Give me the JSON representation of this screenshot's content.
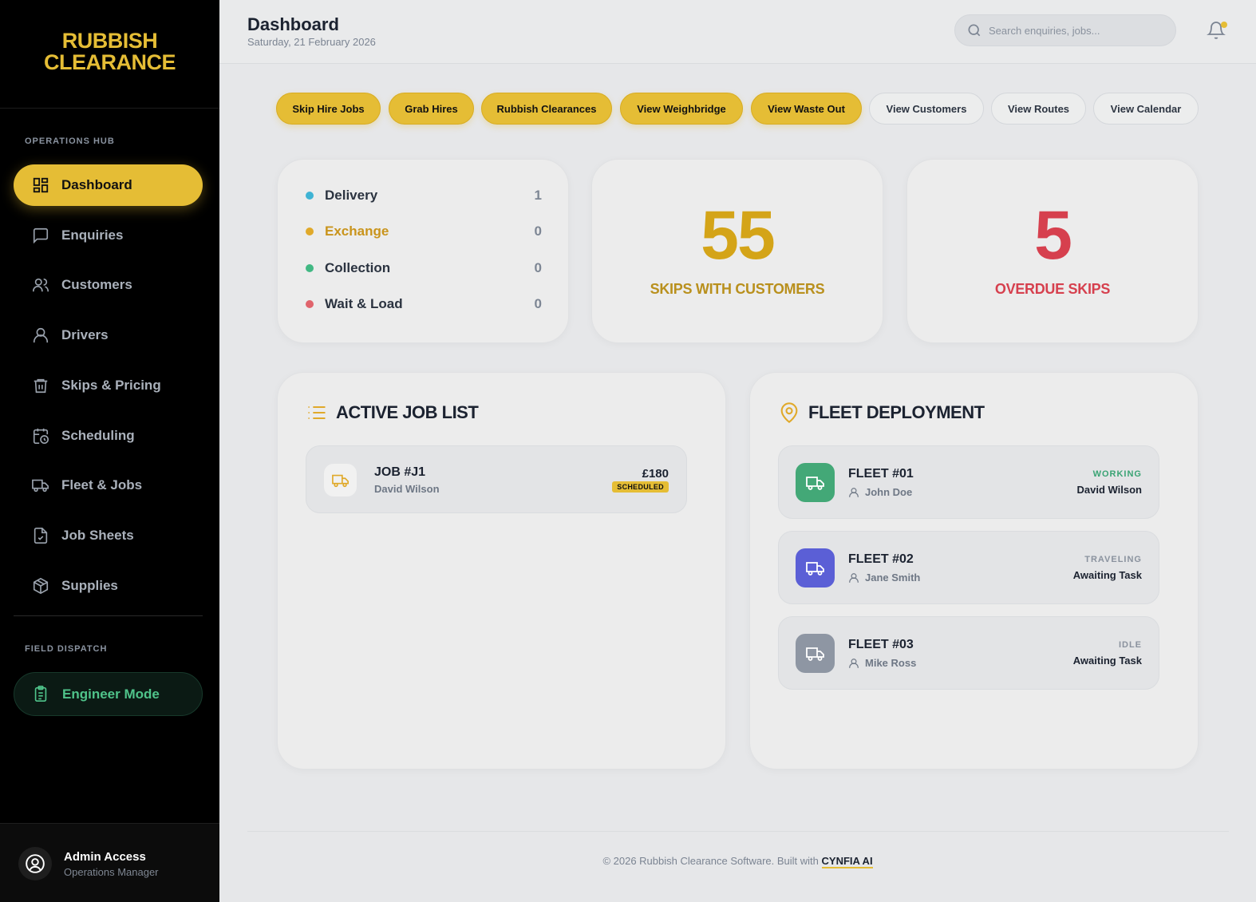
{
  "brand": {
    "line1": "RUBBISH",
    "line2": "CLEARANCE"
  },
  "sidebar": {
    "section_ops": "OPERATIONS HUB",
    "items": [
      {
        "label": "Dashboard",
        "icon": "dashboard-icon",
        "active": true
      },
      {
        "label": "Enquiries",
        "icon": "message-icon"
      },
      {
        "label": "Customers",
        "icon": "users-icon"
      },
      {
        "label": "Drivers",
        "icon": "user-icon"
      },
      {
        "label": "Skips & Pricing",
        "icon": "trash-icon"
      },
      {
        "label": "Scheduling",
        "icon": "calendar-clock-icon"
      },
      {
        "label": "Fleet & Jobs",
        "icon": "truck-icon"
      },
      {
        "label": "Job Sheets",
        "icon": "file-check-icon"
      },
      {
        "label": "Supplies",
        "icon": "package-icon"
      }
    ],
    "section_field": "FIELD DISPATCH",
    "engineer_label": "Engineer Mode",
    "user": {
      "name": "Admin Access",
      "role": "Operations Manager"
    }
  },
  "header": {
    "title": "Dashboard",
    "date": "Saturday, 21 February 2026",
    "search_placeholder": "Search enquiries, jobs..."
  },
  "quick_actions": [
    {
      "label": "Skip Hire Jobs",
      "style": "yellow"
    },
    {
      "label": "Grab Hires",
      "style": "yellow"
    },
    {
      "label": "Rubbish Clearances",
      "style": "yellow"
    },
    {
      "label": "View Weighbridge",
      "style": "yellow"
    },
    {
      "label": "View Waste Out",
      "style": "yellow"
    },
    {
      "label": "View Customers",
      "style": "plain"
    },
    {
      "label": "View Routes",
      "style": "plain"
    },
    {
      "label": "View Calendar",
      "style": "plain"
    }
  ],
  "job_types": [
    {
      "label": "Delivery",
      "count": "1",
      "color": "#3fb3d4"
    },
    {
      "label": "Exchange",
      "count": "0",
      "color": "#e0a92a",
      "label_color": "#c9941c"
    },
    {
      "label": "Collection",
      "count": "0",
      "color": "#41b883"
    },
    {
      "label": "Wait & Load",
      "count": "0",
      "color": "#e0646c"
    }
  ],
  "stats": {
    "skips_with_customers": {
      "value": "55",
      "label": "SKIPS WITH CUSTOMERS",
      "color": "#d4a418",
      "label_color": "#b9901d"
    },
    "overdue_skips": {
      "value": "5",
      "label": "OVERDUE SKIPS",
      "color": "#d6404e",
      "label_color": "#d6404e"
    }
  },
  "active_jobs": {
    "title": "ACTIVE JOB LIST",
    "items": [
      {
        "job": "JOB #J1",
        "customer": "David Wilson",
        "price": "£180",
        "status": "SCHEDULED"
      }
    ]
  },
  "fleet": {
    "title": "FLEET DEPLOYMENT",
    "items": [
      {
        "name": "FLEET #01",
        "driver": "John Doe",
        "status": "WORKING",
        "task": "David Wilson",
        "color": "#43a877",
        "status_color": "#3aa374"
      },
      {
        "name": "FLEET #02",
        "driver": "Jane Smith",
        "status": "TRAVELING",
        "task": "Awaiting Task",
        "color": "#5b5fd6",
        "status_color": "#8a929e"
      },
      {
        "name": "FLEET #03",
        "driver": "Mike Ross",
        "status": "IDLE",
        "task": "Awaiting Task",
        "color": "#8e96a3",
        "status_color": "#8a929e"
      }
    ]
  },
  "footer": {
    "text": "© 2026 Rubbish Clearance Software. Built with",
    "link": "CYNFIA AI"
  }
}
